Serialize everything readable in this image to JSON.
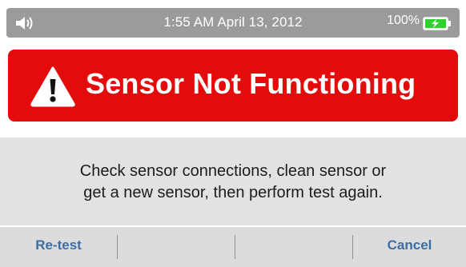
{
  "status_bar": {
    "time": "1:55 AM",
    "date": "April 13, 2012",
    "battery_percent": "100%",
    "sound_icon": "speaker-icon",
    "battery_icon": "battery-charging-icon"
  },
  "alert": {
    "icon": "warning-triangle-icon",
    "title": "Sensor Not Functioning",
    "color": "#e30b0b"
  },
  "message": {
    "line1": "Check sensor connections, clean sensor or",
    "line2": "get a new sensor, then perform test again."
  },
  "buttons": {
    "retest_label": "Re-test",
    "blank1_label": "",
    "blank2_label": "",
    "cancel_label": "Cancel",
    "accent": "#3c6ea6"
  }
}
